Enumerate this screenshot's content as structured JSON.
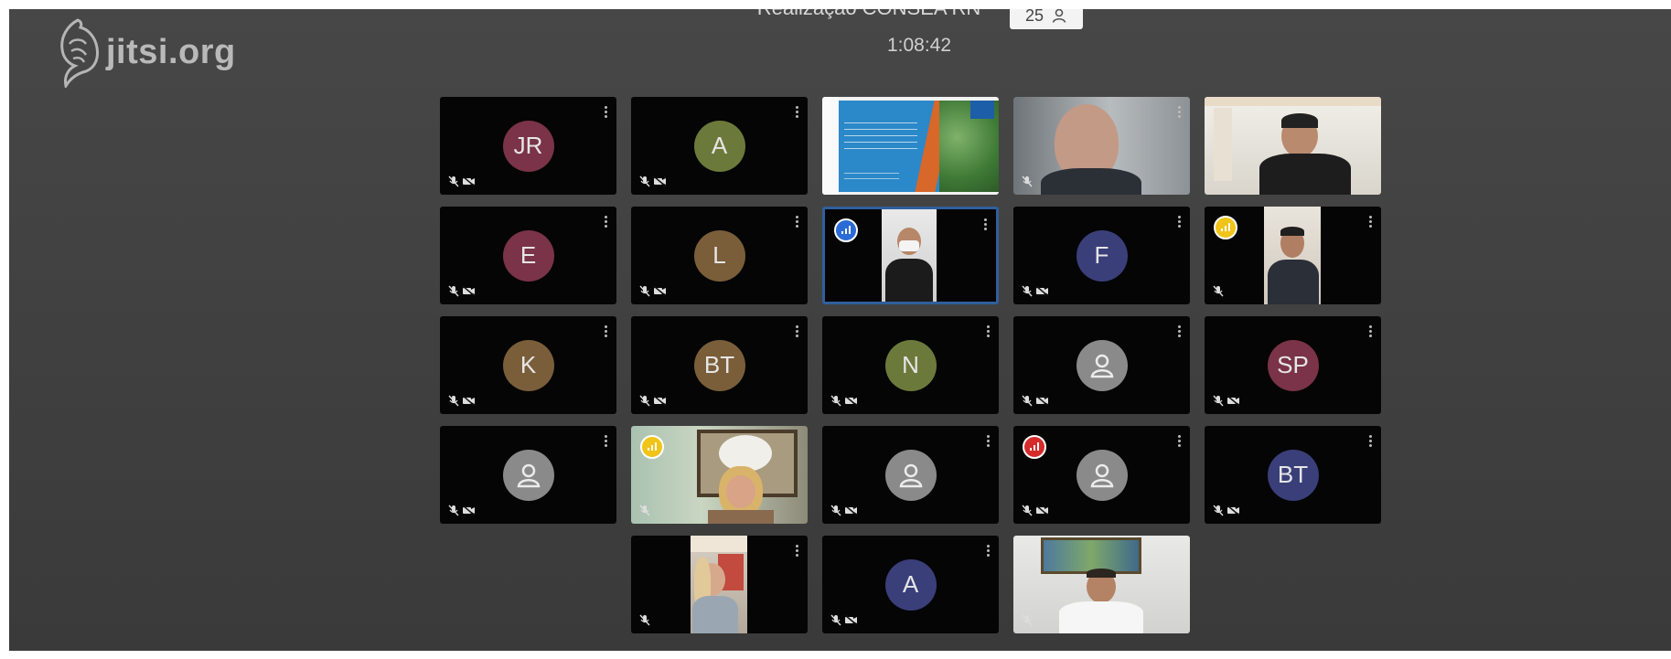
{
  "header": {
    "logo_text": "jitsi.org",
    "meeting_title": "Realização CONSEA RN",
    "participants_count": "25",
    "timer": "1:08:42"
  },
  "tiles": [
    {
      "id": "jr",
      "initials": "JR",
      "avatar_color": "#7a3348",
      "kind": "avatar"
    },
    {
      "id": "a-1",
      "initials": "A",
      "avatar_color": "#6b7a3a",
      "kind": "avatar"
    },
    {
      "id": "presentation",
      "kind": "video"
    },
    {
      "id": "man-glasses",
      "kind": "video"
    },
    {
      "id": "young-man-table",
      "kind": "video"
    },
    {
      "id": "e",
      "initials": "E",
      "avatar_color": "#7a3348",
      "kind": "avatar"
    },
    {
      "id": "l",
      "initials": "L",
      "avatar_color": "#7a5e3a",
      "kind": "avatar"
    },
    {
      "id": "masked-speaker",
      "kind": "video",
      "active": true
    },
    {
      "id": "f",
      "initials": "F",
      "avatar_color": "#3a3f7a",
      "kind": "avatar"
    },
    {
      "id": "young-man-yellow",
      "kind": "video"
    },
    {
      "id": "k",
      "initials": "K",
      "avatar_color": "#7a5e3a",
      "kind": "avatar"
    },
    {
      "id": "bt-1",
      "initials": "BT",
      "avatar_color": "#7a5e3a",
      "kind": "avatar"
    },
    {
      "id": "n",
      "initials": "N",
      "avatar_color": "#6b7a3a",
      "kind": "avatar"
    },
    {
      "id": "anon-1",
      "initials": "",
      "avatar_color": "#8a8a8a",
      "kind": "anon"
    },
    {
      "id": "sp",
      "initials": "SP",
      "avatar_color": "#7a3348",
      "kind": "avatar"
    },
    {
      "id": "anon-2",
      "initials": "",
      "avatar_color": "#8a8a8a",
      "kind": "anon"
    },
    {
      "id": "woman-blonde",
      "kind": "video"
    },
    {
      "id": "anon-3",
      "initials": "",
      "avatar_color": "#8a8a8a",
      "kind": "anon"
    },
    {
      "id": "anon-4",
      "initials": "",
      "avatar_color": "#8a8a8a",
      "kind": "anon"
    },
    {
      "id": "bt-2",
      "initials": "BT",
      "avatar_color": "#3a3f7a",
      "kind": "avatar"
    },
    {
      "id": "woman-portrait",
      "kind": "video"
    },
    {
      "id": "a-2",
      "initials": "A",
      "avatar_color": "#3a3f7a",
      "kind": "avatar"
    },
    {
      "id": "man-white-shirt",
      "kind": "video"
    }
  ],
  "colors": {
    "connection_blue": "#2b6bd6",
    "connection_yellow": "#f0c419",
    "connection_red": "#d62b2b",
    "active_border": "#2f5f9c"
  },
  "icons": {
    "mic_muted": "mic-muted-icon",
    "camera_off": "camera-off-icon",
    "menu": "more-vertical-icon",
    "user": "user-icon",
    "participants": "participants-icon"
  }
}
